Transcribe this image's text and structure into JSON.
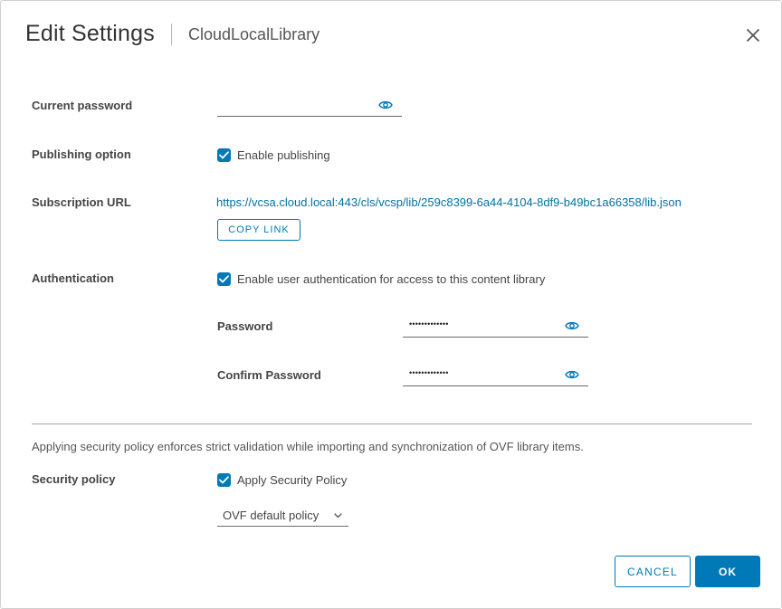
{
  "dialog": {
    "title": "Edit Settings",
    "subtitle": "CloudLocalLibrary"
  },
  "current_password": {
    "label": "Current password",
    "value": ""
  },
  "publishing": {
    "label": "Publishing option",
    "checkbox_label": "Enable publishing",
    "checked": true
  },
  "subscription": {
    "label": "Subscription URL",
    "url": "https://vcsa.cloud.local:443/cls/vcsp/lib/259c8399-6a44-4104-8df9-b49bc1a66358/lib.json",
    "copy_label": "COPY LINK"
  },
  "authentication": {
    "label": "Authentication",
    "checkbox_label": "Enable user authentication for access to this content library",
    "checked": true,
    "password_label": "Password",
    "password_value": "•••••••••••••",
    "confirm_label": "Confirm Password",
    "confirm_value": "•••••••••••••"
  },
  "security": {
    "info": "Applying security policy enforces strict validation while importing and synchronization of OVF library items.",
    "label": "Security policy",
    "checkbox_label": "Apply Security Policy",
    "checked": true,
    "policy_selected": "OVF default policy"
  },
  "footer": {
    "cancel_label": "CANCEL",
    "ok_label": "OK"
  },
  "colors": {
    "accent": "#0079b8",
    "link": "#0072a3"
  },
  "icons": {
    "close": "close-icon",
    "eye": "eye-icon",
    "check": "checkmark-icon",
    "chevron": "chevron-down-icon"
  }
}
